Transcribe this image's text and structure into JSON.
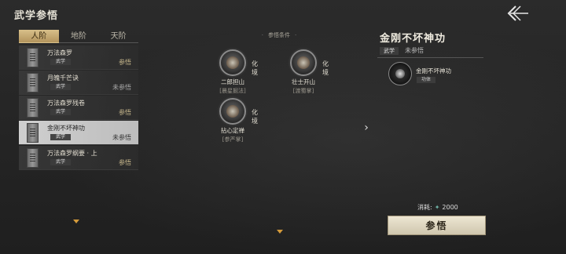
{
  "header": {
    "title": "武学参悟"
  },
  "tabs": [
    {
      "label": "人阶",
      "active": true
    },
    {
      "label": "地阶",
      "active": false
    },
    {
      "label": "天阶",
      "active": false
    }
  ],
  "list": [
    {
      "name": "万法森罗",
      "tag": "武学",
      "status": "参悟",
      "status_color": "gold"
    },
    {
      "name": "月魄千芒诀",
      "tag": "武学",
      "status": "未参悟",
      "status_color": "gray"
    },
    {
      "name": "万法森罗残卷",
      "tag": "武学",
      "status": "参悟",
      "status_color": "gold"
    },
    {
      "name": "金刚不坏神功",
      "tag": "武学",
      "status": "未参悟",
      "status_color": "gray",
      "selected": true
    },
    {
      "name": "万法森罗纲要 · 上",
      "tag": "武学",
      "status": "参悟",
      "status_color": "gold"
    }
  ],
  "conditions": {
    "header": "参悟条件",
    "nodes": [
      {
        "name": "二郎担山",
        "sub": "[晨星掘法]",
        "level": "化境"
      },
      {
        "name": "壮士开山",
        "sub": "[渡蜀掌]",
        "level": "化境"
      },
      {
        "name": "拈心定禅",
        "sub": "[参严掌]",
        "level": "化境"
      }
    ]
  },
  "detail": {
    "title": "金刚不坏神功",
    "tag": "武学",
    "status": "未参悟",
    "skill": {
      "name": "金刚不坏神功",
      "type": "功体"
    },
    "cost_label": "消耗:",
    "cost_value": "2000",
    "action_label": "参悟"
  },
  "colors": {
    "accent_gold": "#c9b98d",
    "tab_active": "#d8c08a",
    "gem": "#6fb3a6"
  }
}
